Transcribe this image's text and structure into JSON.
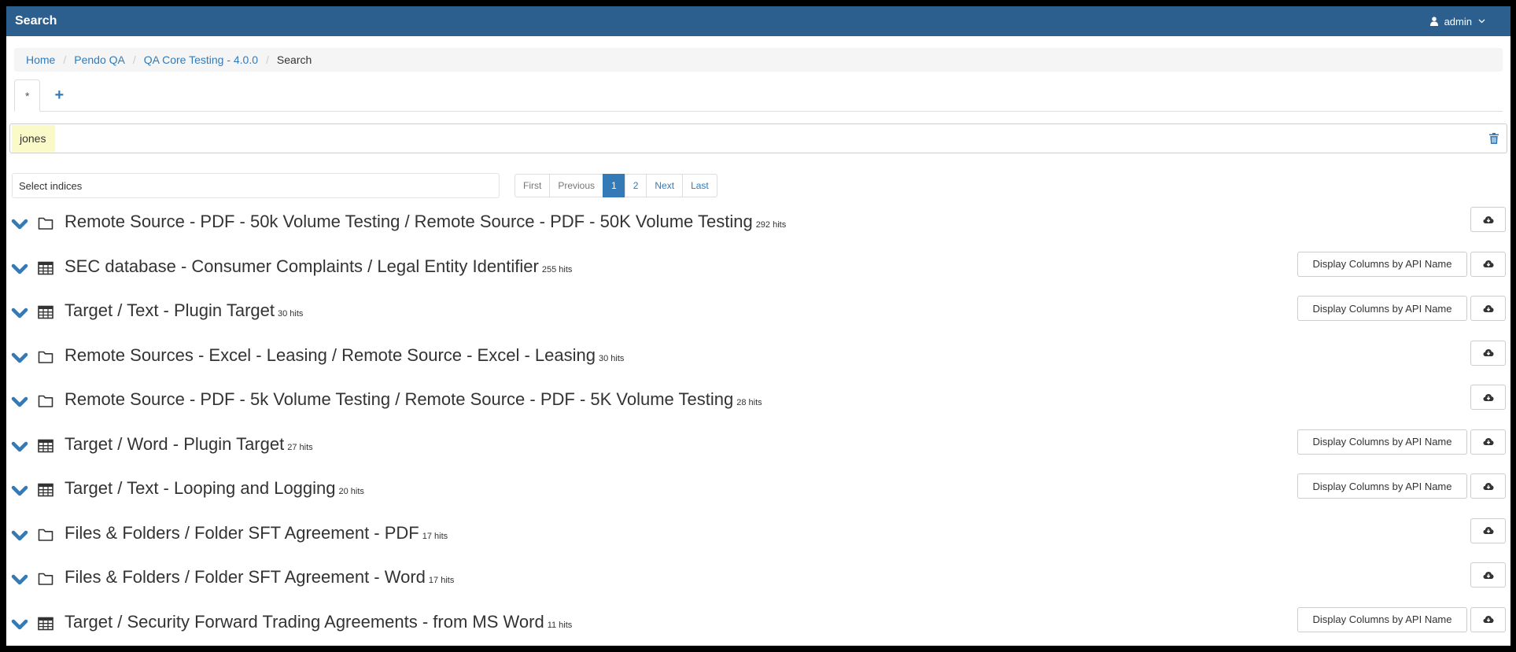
{
  "header": {
    "title": "Search",
    "user": "admin"
  },
  "breadcrumb": [
    {
      "label": "Home"
    },
    {
      "label": "Pendo QA"
    },
    {
      "label": "QA Core Testing - 4.0.0"
    },
    {
      "label": "Search"
    }
  ],
  "tabs": {
    "active_label": "*",
    "add_label": "+"
  },
  "query": {
    "term": "jones"
  },
  "indices": {
    "placeholder": "Select indices"
  },
  "pagination": {
    "first": "First",
    "previous": "Previous",
    "pages": [
      "1",
      "2"
    ],
    "current": "1",
    "next": "Next",
    "last": "Last"
  },
  "labels": {
    "display_columns": "Display Columns by API Name"
  },
  "results": [
    {
      "icon": "folder-icon",
      "title": "Remote Source - PDF - 50k Volume Testing / Remote Source - PDF - 50K Volume Testing",
      "hits": "292 hits",
      "has_columns_button": false
    },
    {
      "icon": "table-icon",
      "title": "SEC database - Consumer Complaints / Legal Entity Identifier",
      "hits": "255 hits",
      "has_columns_button": true
    },
    {
      "icon": "table-icon",
      "title": "Target / Text - Plugin Target",
      "hits": "30 hits",
      "has_columns_button": true
    },
    {
      "icon": "folder-icon",
      "title": "Remote Sources - Excel - Leasing / Remote Source - Excel - Leasing",
      "hits": "30 hits",
      "has_columns_button": false
    },
    {
      "icon": "folder-icon",
      "title": "Remote Source - PDF - 5k Volume Testing / Remote Source - PDF - 5K Volume Testing",
      "hits": "28 hits",
      "has_columns_button": false
    },
    {
      "icon": "table-icon",
      "title": "Target / Word - Plugin Target",
      "hits": "27 hits",
      "has_columns_button": true
    },
    {
      "icon": "table-icon",
      "title": "Target / Text - Looping and Logging",
      "hits": "20 hits",
      "has_columns_button": true
    },
    {
      "icon": "folder-icon",
      "title": "Files & Folders / Folder SFT Agreement - PDF",
      "hits": "17 hits",
      "has_columns_button": false
    },
    {
      "icon": "folder-icon",
      "title": "Files & Folders / Folder SFT Agreement - Word",
      "hits": "17 hits",
      "has_columns_button": false
    },
    {
      "icon": "table-icon",
      "title": "Target / Security Forward Trading Agreements - from MS Word",
      "hits": "11 hits",
      "has_columns_button": true
    }
  ],
  "colors": {
    "header_bg": "#2c5f8d",
    "link": "#337ab7",
    "query_chip_bg": "#fafac8"
  }
}
